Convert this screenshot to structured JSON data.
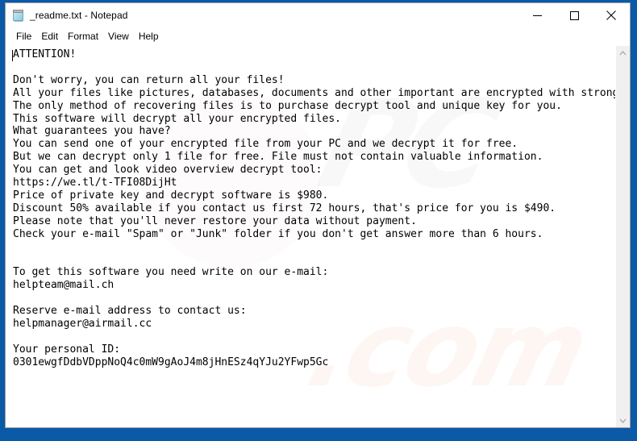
{
  "window": {
    "title": "_readme.txt - Notepad",
    "icon": "notepad-icon",
    "controls": {
      "minimize": "minimize-icon",
      "maximize": "maximize-icon",
      "close": "close-icon"
    }
  },
  "menu": {
    "items": [
      {
        "label": "File"
      },
      {
        "label": "Edit"
      },
      {
        "label": "Format"
      },
      {
        "label": "View"
      },
      {
        "label": "Help"
      }
    ]
  },
  "editor": {
    "content": "ATTENTION!\n\nDon't worry, you can return all your files!\nAll your files like pictures, databases, documents and other important are encrypted with strongest encryption and unique key.\nThe only method of recovering files is to purchase decrypt tool and unique key for you.\nThis software will decrypt all your encrypted files.\nWhat guarantees you have?\nYou can send one of your encrypted file from your PC and we decrypt it for free.\nBut we can decrypt only 1 file for free. File must not contain valuable information.\nYou can get and look video overview decrypt tool:\nhttps://we.tl/t-TFI08DijHt\nPrice of private key and decrypt software is $980.\nDiscount 50% available if you contact us first 72 hours, that's price for you is $490.\nPlease note that you'll never restore your data without payment.\nCheck your e-mail \"Spam\" or \"Junk\" folder if you don't get answer more than 6 hours.\n\n\nTo get this software you need write on our e-mail:\nhelpteam@mail.ch\n\nReserve e-mail address to contact us:\nhelpmanager@airmail.cc\n\nYour personal ID:\n0301ewgfDdbVDppNoQ4c0mW9gAoJ4m8jHnESz4qYJu2YFwp5Gc",
    "ransom_details": {
      "video_url": "https://we.tl/t-TFI08DijHt",
      "price_full": "$980",
      "price_discount": "$490",
      "discount_percent": "50%",
      "discount_window": "72 hours",
      "response_time": "6 hours",
      "free_decrypt_files": "1 file",
      "primary_email": "helpteam@mail.ch",
      "reserve_email": "helpmanager@airmail.cc",
      "personal_id": "0301ewgfDdbVDppNoQ4c0mW9gAoJ4m8jHnESz4qYJu2YFwp5Gc"
    }
  },
  "watermark": {
    "top_text": "PC",
    "bottom_text": ".com"
  },
  "scrollbar": {
    "up_arrow": "chevron-up-icon",
    "down_arrow": "chevron-down-icon"
  },
  "colors": {
    "frame_blue": "#0a5aa8",
    "window_bg": "#ffffff",
    "scrollbar_track": "#f0f0f0",
    "text": "#000000"
  }
}
